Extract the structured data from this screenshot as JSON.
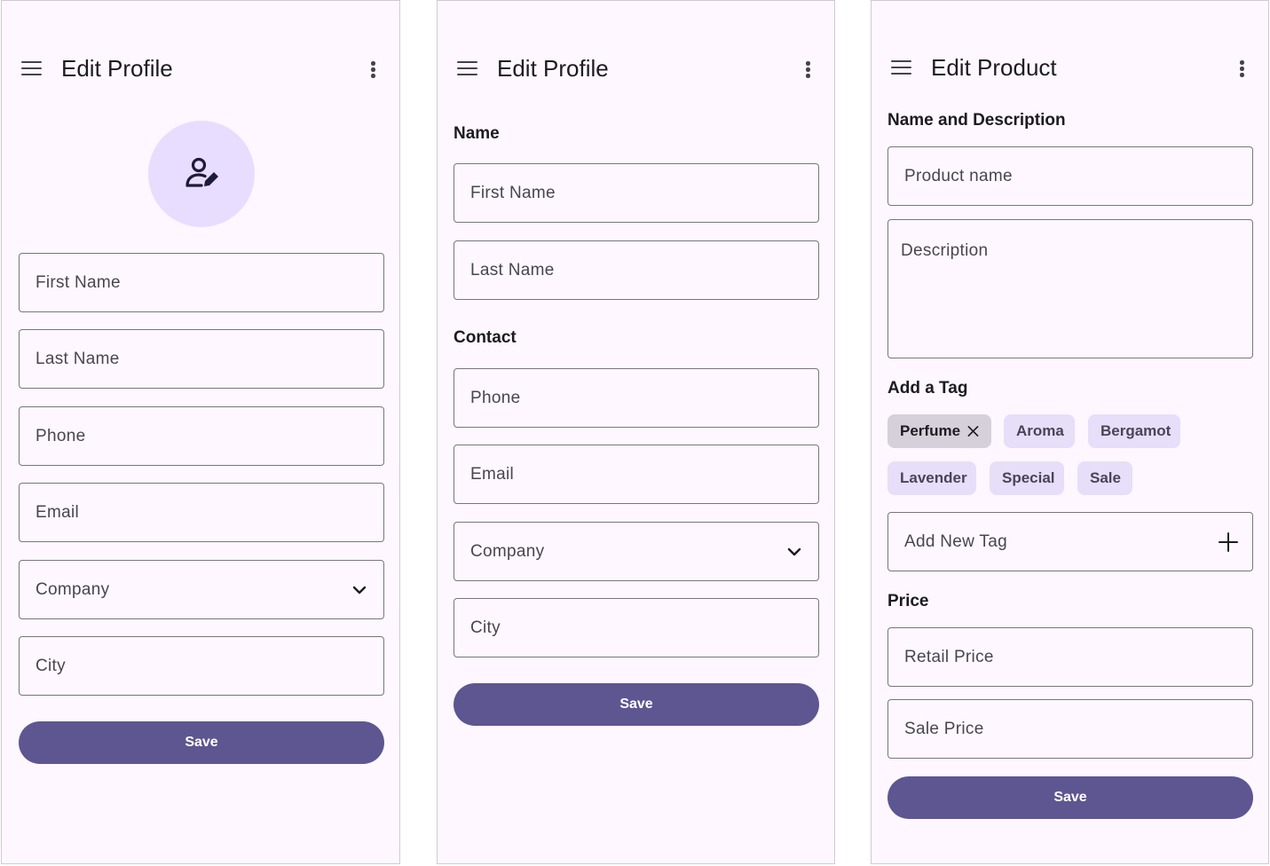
{
  "colors": {
    "surface": "#fef7ff",
    "primary": "#5e5691",
    "outline": "#79747e",
    "chip": "#e7defa",
    "chip_selected": "#d6d0da",
    "avatar_bg": "#e9ddff"
  },
  "screen1": {
    "title": "Edit Profile",
    "icons": [
      "menu-icon",
      "more-vert-icon",
      "edit-person-icon"
    ],
    "fields": {
      "first_name": "First Name",
      "last_name": "Last Name",
      "phone": "Phone",
      "email": "Email",
      "company": "Company",
      "city": "City"
    },
    "save_label": "Save"
  },
  "screen2": {
    "title": "Edit Profile",
    "sections": {
      "name": "Name",
      "contact": "Contact"
    },
    "fields": {
      "first_name": "First Name",
      "last_name": "Last Name",
      "phone": "Phone",
      "email": "Email",
      "company": "Company",
      "city": "City"
    },
    "save_label": "Save"
  },
  "screen3": {
    "title": "Edit Product",
    "sections": {
      "name_desc": "Name and Description",
      "tags": "Add a Tag",
      "price": "Price"
    },
    "fields": {
      "product_name": "Product name",
      "description": "Description",
      "add_tag": "Add New Tag",
      "retail_price": "Retail Price",
      "sale_price": "Sale Price"
    },
    "tags": [
      {
        "label": "Perfume",
        "selected": true
      },
      {
        "label": "Aroma",
        "selected": false
      },
      {
        "label": "Bergamot",
        "selected": false
      },
      {
        "label": "Lavender",
        "selected": false
      },
      {
        "label": "Special",
        "selected": false
      },
      {
        "label": "Sale",
        "selected": false
      }
    ],
    "save_label": "Save"
  }
}
